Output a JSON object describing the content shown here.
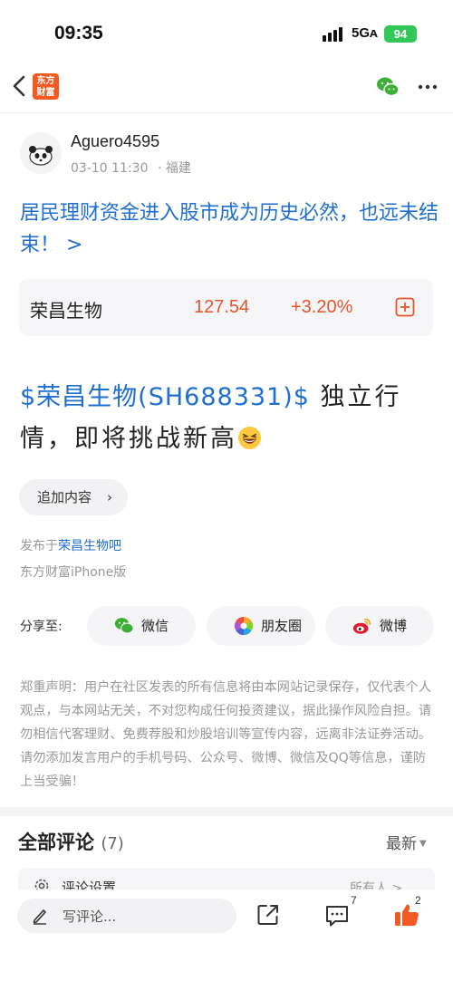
{
  "status_bar": {
    "time": "09:35",
    "network": "5Gᴀ",
    "battery": "94"
  },
  "nav": {
    "logo_text_line1": "东方",
    "logo_text_line2": "财富",
    "icons": [
      "back-icon",
      "wechat-icon",
      "more-icon"
    ]
  },
  "author": {
    "name": "Aguero4595",
    "date": "03-10 11:30",
    "location": "· 福建"
  },
  "headline": "居民理财资金进入股市成为历史必然，也远未结束！ >",
  "stock": {
    "name": "荣昌生物",
    "price": "127.54",
    "change": "+3.20%",
    "accent_color": "#e8542a"
  },
  "post": {
    "tag": "$荣昌生物(SH688331)$",
    "text": " 独立行情，即将挑战新高"
  },
  "add_content_label": "追加内容",
  "published": {
    "prefix": "发布于",
    "bar": "荣昌生物吧",
    "device": "东方财富iPhone版"
  },
  "share": {
    "label": "分享至:",
    "buttons": [
      {
        "label": "微信",
        "icon": "wechat-icon"
      },
      {
        "label": "朋友圈",
        "icon": "moments-icon"
      },
      {
        "label": "微博",
        "icon": "weibo-icon"
      }
    ]
  },
  "disclaimer": "郑重声明：用户在社区发表的所有信息将由本网站记录保存，仅代表个人观点，与本网站无关，不对您构成任何投资建议，据此操作风险自担。请勿相信代客理财、免费荐股和炒股培训等宣传内容，远离非法证券活动。请勿添加发言用户的手机号码、公众号、微博、微信及QQ等信息，谨防上当受骗！",
  "comments": {
    "title": "全部评论",
    "count": "(7)",
    "sort": "最新",
    "settings_label": "评论设置",
    "settings_value": "所有人 >"
  },
  "bottom_bar": {
    "comment_placeholder": "写评论...",
    "comment_count": "7",
    "like_count": "2"
  },
  "colors": {
    "link_blue": "#1f6fd0",
    "brand_orange": "#f15a22",
    "up_red": "#e8542a"
  }
}
